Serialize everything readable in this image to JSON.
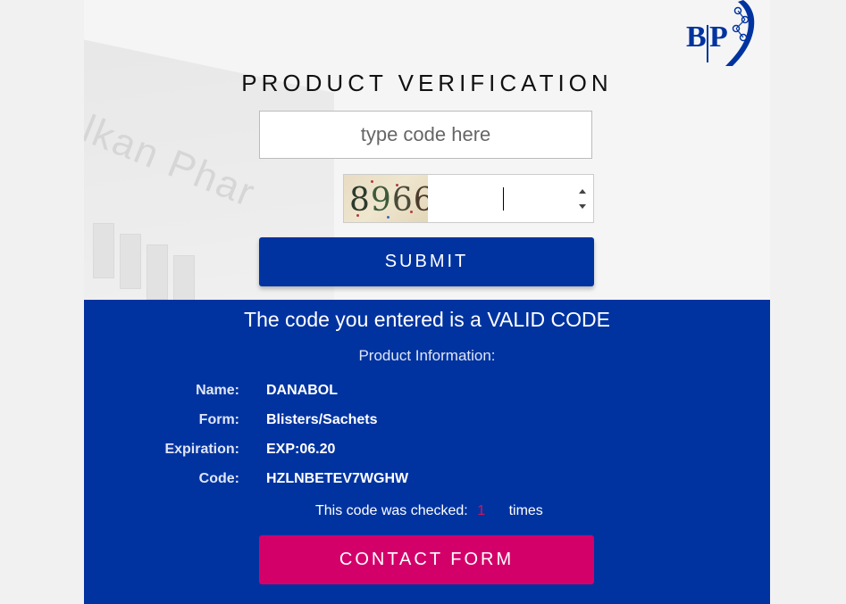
{
  "header": {
    "title": "PRODUCT VERIFICATION",
    "logo_text": "BP"
  },
  "form": {
    "code_placeholder": "type code here",
    "captcha_digits": [
      "8",
      "9",
      "6",
      "6"
    ],
    "captcha_value": "",
    "submit_label": "SUBMIT"
  },
  "result": {
    "heading": "The code you entered is a VALID CODE",
    "info_heading": "Product Information:",
    "fields": [
      {
        "label": "Name:",
        "value": "DANABOL"
      },
      {
        "label": "Form:",
        "value": "Blisters/Sachets"
      },
      {
        "label": "Expiration:",
        "value": "EXP:06.20"
      },
      {
        "label": "Code:",
        "value": "HZLNBETEV7WGHW"
      }
    ],
    "checked_prefix": "This code was checked:",
    "checked_count": "1",
    "checked_suffix": "times",
    "contact_label": "CONTACT FORM"
  },
  "colors": {
    "primary_blue": "#0033a0",
    "accent_pink": "#d4006a",
    "count_pink": "#d4145a",
    "page_bg": "#f1f1f1"
  }
}
